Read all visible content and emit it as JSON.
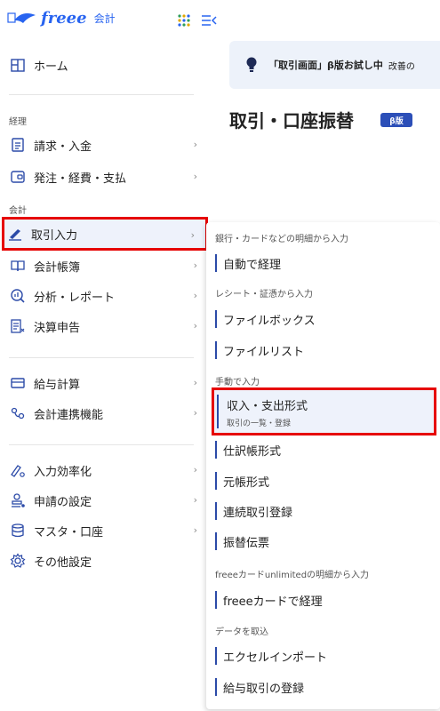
{
  "logo": {
    "word": "freee",
    "sub": "会計"
  },
  "sidebar": {
    "home": "ホーム",
    "section_keiri": "経理",
    "seikyu": "請求・入金",
    "hacchu": "発注・経費・支払",
    "section_kaikei": "会計",
    "torihiki": "取引入力",
    "choubo": "会計帳簿",
    "bunseki": "分析・レポート",
    "kessan": "決算申告",
    "kyuyo": "給与計算",
    "renkei": "会計連携機能",
    "kouritsu": "入力効率化",
    "shinsei": "申請の設定",
    "master": "マスタ・口座",
    "sonota": "その他設定",
    "chevron": "›"
  },
  "banner": {
    "text1": "「取引画面」β版お試し中",
    "text2": "改善の"
  },
  "page": {
    "title": "取引・口座振替",
    "badge": "β版"
  },
  "flyout": {
    "sec1": "銀行・カードなどの明細から入力",
    "jidou": "自動で経理",
    "sec2": "レシート・証憑から入力",
    "filebox": "ファイルボックス",
    "filelist": "ファイルリスト",
    "sec3": "手動で入力",
    "shushi": "収入・支出形式",
    "shushi_sub": "取引の一覧・登録",
    "shiwake": "仕訳帳形式",
    "motocho": "元帳形式",
    "renzoku": "連続取引登録",
    "furikae": "振替伝票",
    "sec4": "freeeカードunlimitedの明細から入力",
    "freeecard": "freeeカードで経理",
    "sec5": "データを取込",
    "excel": "エクセルインポート",
    "kyuyotori": "給与取引の登録"
  }
}
